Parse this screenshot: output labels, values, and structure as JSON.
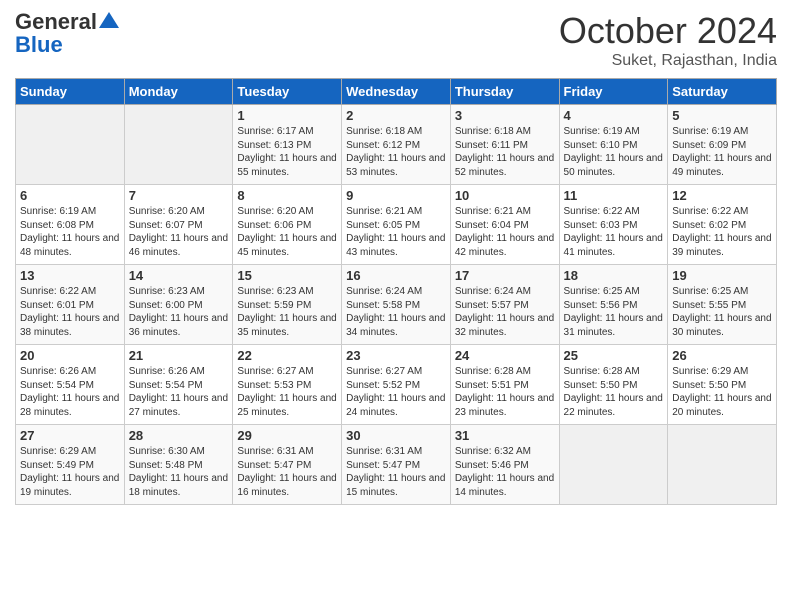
{
  "header": {
    "logo_general": "General",
    "logo_blue": "Blue",
    "month": "October 2024",
    "location": "Suket, Rajasthan, India"
  },
  "days_of_week": [
    "Sunday",
    "Monday",
    "Tuesday",
    "Wednesday",
    "Thursday",
    "Friday",
    "Saturday"
  ],
  "weeks": [
    [
      {
        "day": "",
        "content": ""
      },
      {
        "day": "",
        "content": ""
      },
      {
        "day": "1",
        "content": "Sunrise: 6:17 AM\nSunset: 6:13 PM\nDaylight: 11 hours\nand 55 minutes."
      },
      {
        "day": "2",
        "content": "Sunrise: 6:18 AM\nSunset: 6:12 PM\nDaylight: 11 hours\nand 53 minutes."
      },
      {
        "day": "3",
        "content": "Sunrise: 6:18 AM\nSunset: 6:11 PM\nDaylight: 11 hours\nand 52 minutes."
      },
      {
        "day": "4",
        "content": "Sunrise: 6:19 AM\nSunset: 6:10 PM\nDaylight: 11 hours\nand 50 minutes."
      },
      {
        "day": "5",
        "content": "Sunrise: 6:19 AM\nSunset: 6:09 PM\nDaylight: 11 hours\nand 49 minutes."
      }
    ],
    [
      {
        "day": "6",
        "content": "Sunrise: 6:19 AM\nSunset: 6:08 PM\nDaylight: 11 hours\nand 48 minutes."
      },
      {
        "day": "7",
        "content": "Sunrise: 6:20 AM\nSunset: 6:07 PM\nDaylight: 11 hours\nand 46 minutes."
      },
      {
        "day": "8",
        "content": "Sunrise: 6:20 AM\nSunset: 6:06 PM\nDaylight: 11 hours\nand 45 minutes."
      },
      {
        "day": "9",
        "content": "Sunrise: 6:21 AM\nSunset: 6:05 PM\nDaylight: 11 hours\nand 43 minutes."
      },
      {
        "day": "10",
        "content": "Sunrise: 6:21 AM\nSunset: 6:04 PM\nDaylight: 11 hours\nand 42 minutes."
      },
      {
        "day": "11",
        "content": "Sunrise: 6:22 AM\nSunset: 6:03 PM\nDaylight: 11 hours\nand 41 minutes."
      },
      {
        "day": "12",
        "content": "Sunrise: 6:22 AM\nSunset: 6:02 PM\nDaylight: 11 hours\nand 39 minutes."
      }
    ],
    [
      {
        "day": "13",
        "content": "Sunrise: 6:22 AM\nSunset: 6:01 PM\nDaylight: 11 hours\nand 38 minutes."
      },
      {
        "day": "14",
        "content": "Sunrise: 6:23 AM\nSunset: 6:00 PM\nDaylight: 11 hours\nand 36 minutes."
      },
      {
        "day": "15",
        "content": "Sunrise: 6:23 AM\nSunset: 5:59 PM\nDaylight: 11 hours\nand 35 minutes."
      },
      {
        "day": "16",
        "content": "Sunrise: 6:24 AM\nSunset: 5:58 PM\nDaylight: 11 hours\nand 34 minutes."
      },
      {
        "day": "17",
        "content": "Sunrise: 6:24 AM\nSunset: 5:57 PM\nDaylight: 11 hours\nand 32 minutes."
      },
      {
        "day": "18",
        "content": "Sunrise: 6:25 AM\nSunset: 5:56 PM\nDaylight: 11 hours\nand 31 minutes."
      },
      {
        "day": "19",
        "content": "Sunrise: 6:25 AM\nSunset: 5:55 PM\nDaylight: 11 hours\nand 30 minutes."
      }
    ],
    [
      {
        "day": "20",
        "content": "Sunrise: 6:26 AM\nSunset: 5:54 PM\nDaylight: 11 hours\nand 28 minutes."
      },
      {
        "day": "21",
        "content": "Sunrise: 6:26 AM\nSunset: 5:54 PM\nDaylight: 11 hours\nand 27 minutes."
      },
      {
        "day": "22",
        "content": "Sunrise: 6:27 AM\nSunset: 5:53 PM\nDaylight: 11 hours\nand 25 minutes."
      },
      {
        "day": "23",
        "content": "Sunrise: 6:27 AM\nSunset: 5:52 PM\nDaylight: 11 hours\nand 24 minutes."
      },
      {
        "day": "24",
        "content": "Sunrise: 6:28 AM\nSunset: 5:51 PM\nDaylight: 11 hours\nand 23 minutes."
      },
      {
        "day": "25",
        "content": "Sunrise: 6:28 AM\nSunset: 5:50 PM\nDaylight: 11 hours\nand 22 minutes."
      },
      {
        "day": "26",
        "content": "Sunrise: 6:29 AM\nSunset: 5:50 PM\nDaylight: 11 hours\nand 20 minutes."
      }
    ],
    [
      {
        "day": "27",
        "content": "Sunrise: 6:29 AM\nSunset: 5:49 PM\nDaylight: 11 hours\nand 19 minutes."
      },
      {
        "day": "28",
        "content": "Sunrise: 6:30 AM\nSunset: 5:48 PM\nDaylight: 11 hours\nand 18 minutes."
      },
      {
        "day": "29",
        "content": "Sunrise: 6:31 AM\nSunset: 5:47 PM\nDaylight: 11 hours\nand 16 minutes."
      },
      {
        "day": "30",
        "content": "Sunrise: 6:31 AM\nSunset: 5:47 PM\nDaylight: 11 hours\nand 15 minutes."
      },
      {
        "day": "31",
        "content": "Sunrise: 6:32 AM\nSunset: 5:46 PM\nDaylight: 11 hours\nand 14 minutes."
      },
      {
        "day": "",
        "content": ""
      },
      {
        "day": "",
        "content": ""
      }
    ]
  ]
}
